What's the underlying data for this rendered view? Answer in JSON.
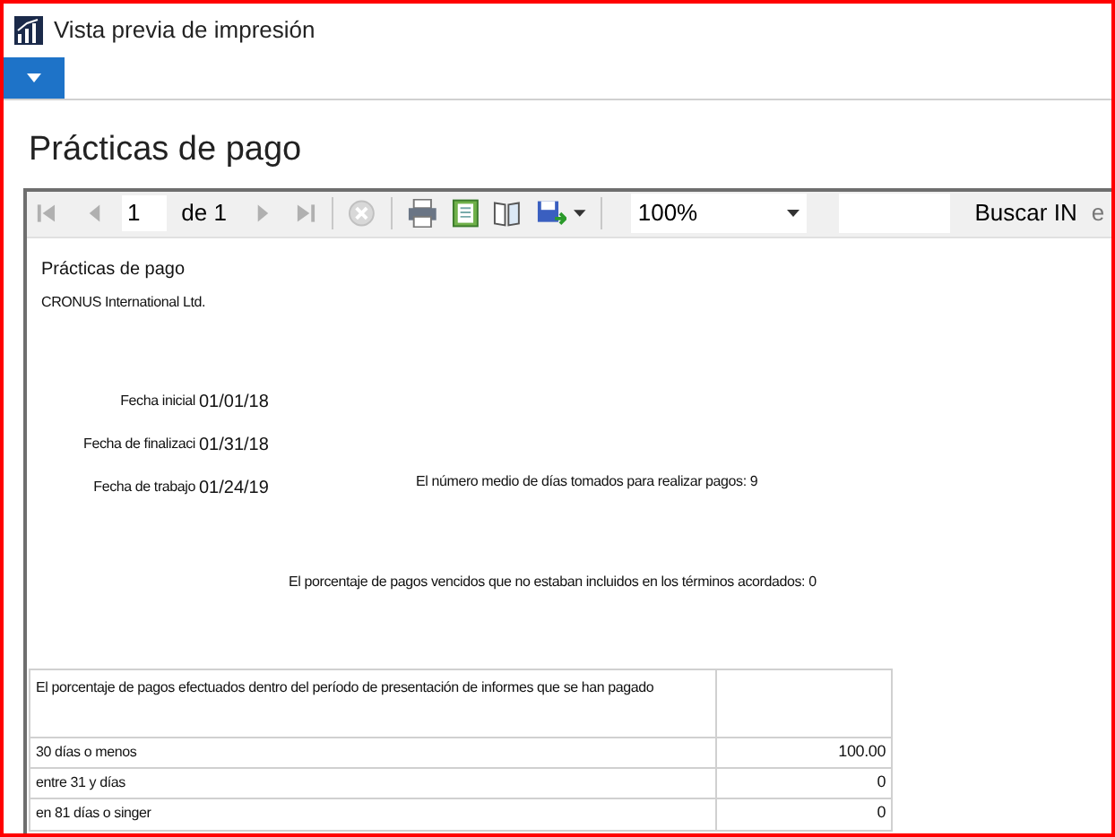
{
  "window": {
    "title": "Vista previa de impresión"
  },
  "page_title": "Prácticas de pago",
  "toolbar": {
    "page": "1",
    "page_of": "de 1",
    "zoom": "100%",
    "search_label": "Buscar IN",
    "cut_text": "e"
  },
  "report": {
    "title": "Prácticas de pago",
    "company": "CRONUS International Ltd.",
    "fields": [
      {
        "label": "Fecha inicial",
        "value": "01/01/18"
      },
      {
        "label": "Fecha de finalizaci",
        "value": "01/31/18"
      },
      {
        "label": "Fecha de trabajo",
        "value": "01/24/19"
      }
    ],
    "average_days": "El número medio de días tomados para realizar pagos: 9",
    "overdue_percent": "El porcentaje de pagos vencidos que no estaban incluidos en los términos acordados: 0",
    "table": {
      "header": "El porcentaje de pagos efectuados dentro del período de presentación de informes que se han pagado",
      "rows": [
        {
          "label": "30 días o menos",
          "value": "100.00"
        },
        {
          "label": "entre 31 y días",
          "value": "0"
        },
        {
          "label": "en 81 días o singer",
          "value": "0"
        }
      ]
    }
  }
}
